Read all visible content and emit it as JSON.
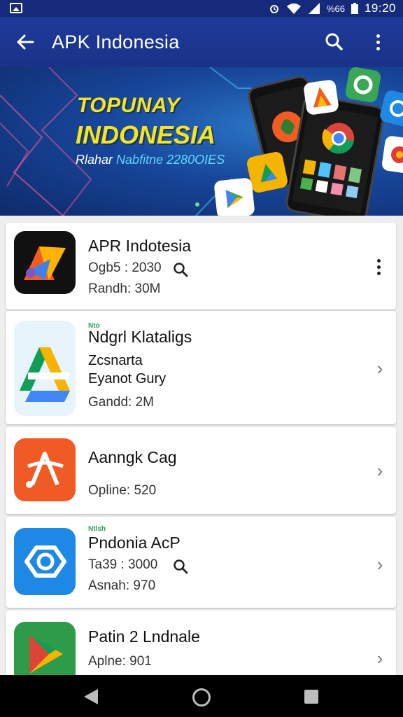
{
  "status_bar": {
    "battery_text": "%66",
    "time": "19:20",
    "icons": [
      "image-icon",
      "alarm-icon",
      "wifi-icon",
      "signal-icon",
      "battery-icon"
    ]
  },
  "app_bar": {
    "title": "APK Indonesia",
    "icons": [
      "back-arrow-icon",
      "search-icon",
      "more-vert-icon"
    ]
  },
  "banner": {
    "line1": "TOPUNAY",
    "line2": "INDONESIA",
    "sub_a": "Rlahar",
    "sub_b": "Nabfitne 2280OIES"
  },
  "apps": [
    {
      "name": "APR Indotesia",
      "meta1": "Ogb5 : 2030",
      "meta2": "Randh:  30M",
      "action": "overflow",
      "icon": "stylized-a-icon",
      "colors": [
        "#111111",
        "#f25c22",
        "#3f7fe8"
      ]
    },
    {
      "tag": "Nto",
      "name": "Ndgrl Klataligs",
      "meta1": "Zcsnarta",
      "meta2": "Eyanot Gury",
      "meta3": "Gandd:  2M",
      "action": "chevron",
      "icon": "drive-style-icon"
    },
    {
      "name": "Aanngk Cag",
      "meta1": "Opline:  520",
      "action": "chevron",
      "icon": "orange-a-icon",
      "colors": [
        "#f05a24",
        "#ff7a32"
      ]
    },
    {
      "tag": "Ntlsh",
      "name": "Pndonia AcP",
      "meta1": "Ta39 : 3000",
      "meta2": "Asnah:  970",
      "action": "chevron",
      "icon": "camera-lens-icon",
      "colors": [
        "#1e88e5",
        "#42a5f5"
      ]
    },
    {
      "name": "Patin 2 Lndnale",
      "meta1": "Aplne:  901",
      "action": "chevron",
      "icon": "play-triangle-icon"
    }
  ],
  "nav_bar": {
    "icons": [
      "nav-back-icon",
      "nav-home-icon",
      "nav-recents-icon"
    ]
  }
}
